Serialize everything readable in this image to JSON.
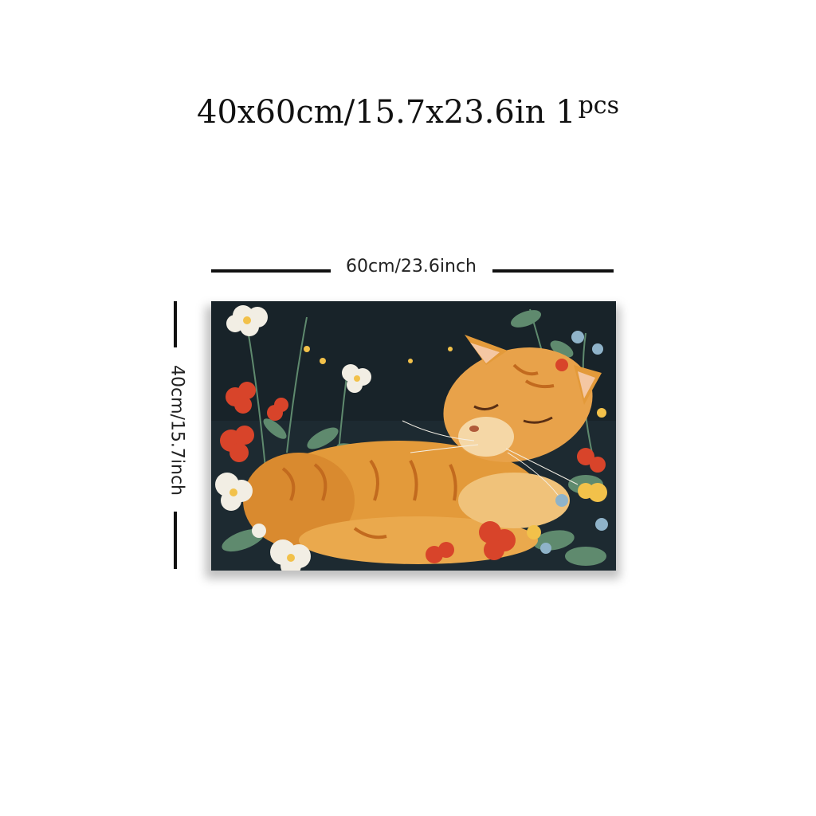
{
  "title": {
    "size_text": "40x60cm/15.7x23.6in",
    "quantity": "1",
    "quantity_unit": "pcs"
  },
  "dimensions": {
    "width_label": "60cm/23.6inch",
    "height_label": "40cm/15.7inch"
  },
  "artwork": {
    "subject": "sleeping orange tabby cat among flowers",
    "colors": {
      "background": "#1d2a31",
      "cat": "#e39a3a",
      "cat_stripe": "#c26a1e",
      "flower_red": "#d8442a",
      "flower_white": "#f2eee4",
      "flower_yellow": "#f2c14a",
      "leaf": "#5f8a6e"
    }
  }
}
